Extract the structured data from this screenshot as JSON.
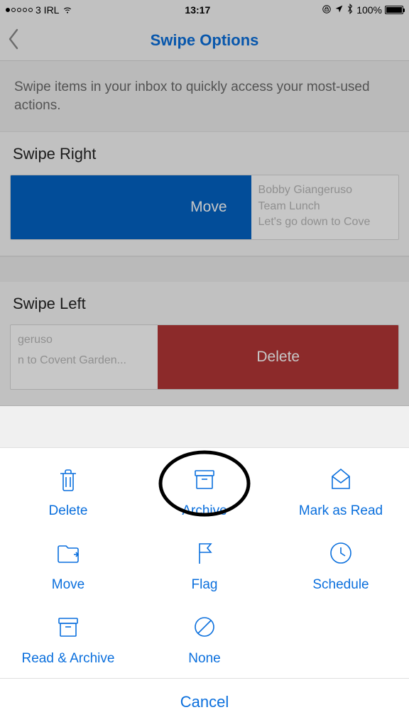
{
  "statusbar": {
    "carrier": "3 IRL",
    "time": "13:17",
    "battery_pct": "100%"
  },
  "nav": {
    "title": "Swipe Options"
  },
  "description": "Swipe items in your inbox to quickly access your most-used actions.",
  "swipe_right": {
    "heading": "Swipe Right",
    "action_label": "Move",
    "preview_from": "Bobby Giangeruso",
    "preview_subject": "Team Lunch",
    "preview_snippet": "Let's go down to Cove"
  },
  "swipe_left": {
    "heading": "Swipe Left",
    "action_label": "Delete",
    "preview_from_partial": "geruso",
    "preview_snippet_partial": "n to Covent Garden..."
  },
  "sheet": {
    "options": {
      "delete": "Delete",
      "archive": "Archive",
      "markread": "Mark as Read",
      "move": "Move",
      "flag": "Flag",
      "schedule": "Schedule",
      "readarch": "Read & Archive",
      "none": "None"
    },
    "cancel": "Cancel",
    "highlighted": "archive"
  },
  "colors": {
    "accent": "#0a6fdd",
    "swipe_right_bg": "#0363c4",
    "swipe_left_bg": "#b33636"
  }
}
